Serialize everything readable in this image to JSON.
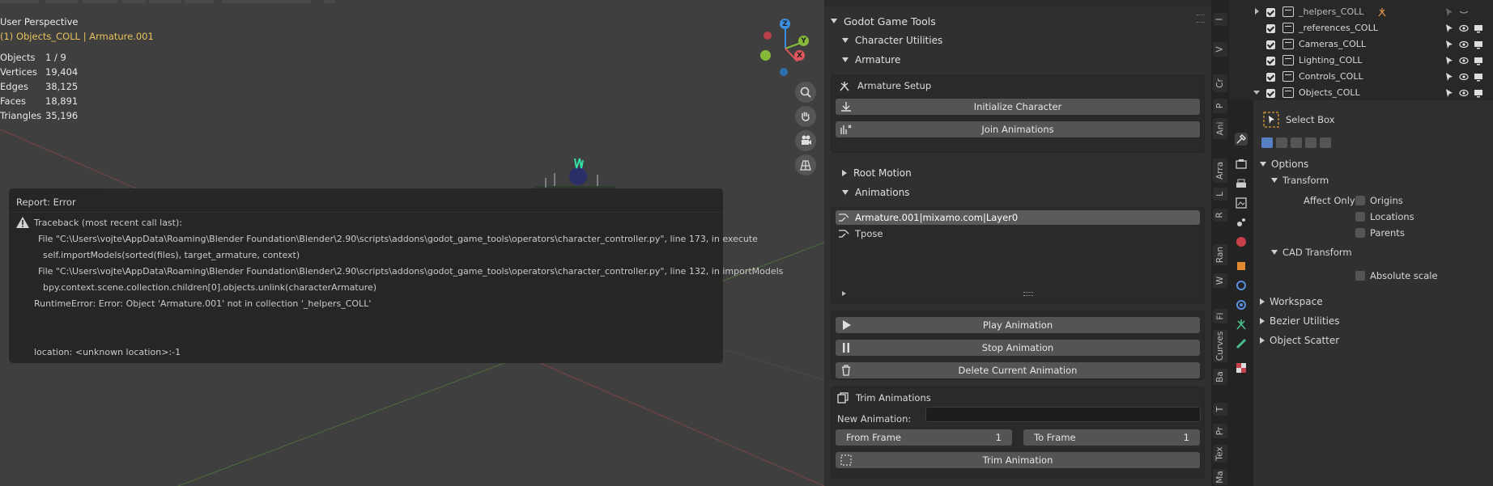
{
  "viewport": {
    "perspective": "User Perspective",
    "collection": "(1) Objects_COLL | Armature.001",
    "stats": [
      {
        "k": "Objects",
        "v": "1 / 9"
      },
      {
        "k": "Vertices",
        "v": "19,404"
      },
      {
        "k": "Edges",
        "v": "38,125"
      },
      {
        "k": "Faces",
        "v": "18,891"
      },
      {
        "k": "Triangles",
        "v": "35,196"
      }
    ],
    "gizmo": {
      "z": "Z",
      "y": "Y",
      "x": "X"
    }
  },
  "report": {
    "title": "Report: Error",
    "lines": [
      "Traceback (most recent call last):",
      "File \"C:\\Users\\vojte\\AppData\\Roaming\\Blender Foundation\\Blender\\2.90\\scripts\\addons\\godot_game_tools\\operators\\character_controller.py\", line 173, in execute",
      "self.importModels(sorted(files), target_armature, context)",
      "File \"C:\\Users\\vojte\\AppData\\Roaming\\Blender Foundation\\Blender\\2.90\\scripts\\addons\\godot_game_tools\\operators\\character_controller.py\", line 132, in importModels",
      "bpy.context.scene.collection.children[0].objects.unlink(characterArmature)",
      "RuntimeError: Error: Object 'Armature.001' not in collection '_helpers_COLL'",
      "location: <unknown location>:-1"
    ]
  },
  "npanel": {
    "title": "Godot Game Tools",
    "character_utilities": "Character Utilities",
    "armature": "Armature",
    "armature_setup": "Armature Setup",
    "initialize_character": "Initialize Character",
    "join_animations": "Join Animations",
    "root_motion": "Root Motion",
    "animations": "Animations",
    "animation_list": [
      "Armature.001|mixamo.com|Layer0",
      "Tpose"
    ],
    "play_animation": "Play Animation",
    "stop_animation": "Stop Animation",
    "delete_current_animation": "Delete Current Animation",
    "trim_animations": "Trim Animations",
    "new_animation_label": "New Animation:",
    "new_animation_value": "",
    "from_frame_label": "From Frame",
    "from_frame_value": "1",
    "to_frame_label": "To Frame",
    "to_frame_value": "1",
    "trim_animation": "Trim Animation"
  },
  "tabs": [
    "I",
    "V",
    "Cr",
    "P",
    "Ani",
    "Arra",
    "L",
    "R",
    "Ran",
    "W",
    "Fl",
    "Curves",
    "Ba",
    "T",
    "Pr",
    "Tex",
    "Ma"
  ],
  "outliner": {
    "rows": [
      "_helpers_COLL",
      "_references_COLL",
      "Cameras_COLL",
      "Lighting_COLL",
      "Controls_COLL",
      "Objects_COLL"
    ]
  },
  "properties": {
    "tool": "Select Box",
    "options": "Options",
    "transform": "Transform",
    "affect_only": "Affect Only",
    "origins": "Origins",
    "locations": "Locations",
    "parents": "Parents",
    "cad_transform": "CAD Transform",
    "absolute_scale": "Absolute scale",
    "workspace": "Workspace",
    "bezier_utilities": "Bezier Utilities",
    "object_scatter": "Object Scatter"
  },
  "colors": {
    "viewport_bg": "#3f3f3f",
    "collection_text": "#e8c25a",
    "axis_x": "#e0555e",
    "axis_y": "#86b83a",
    "axis_z": "#3a8fe0"
  }
}
